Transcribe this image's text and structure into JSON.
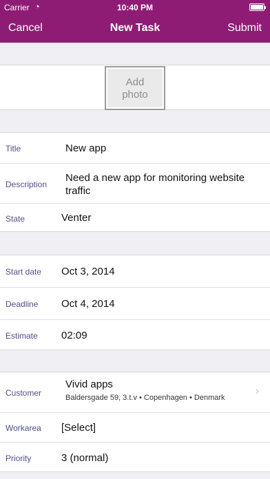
{
  "status": {
    "carrier": "Carrier",
    "time": "10:40 PM"
  },
  "nav": {
    "cancel": "Cancel",
    "title": "New Task",
    "submit": "Submit"
  },
  "photo": {
    "line1": "Add",
    "line2": "photo"
  },
  "task": {
    "title_label": "Title",
    "title_value": "New app",
    "description_label": "Description",
    "description_line1": "Need a new app for monitoring website",
    "description_line2": "traffic",
    "state_label": "State",
    "state_value": "Venter"
  },
  "schedule": {
    "start_label": "Start date",
    "start_value": "Oct 3, 2014",
    "deadline_label": "Deadline",
    "deadline_value": "Oct 4, 2014",
    "estimate_label": "Estimate",
    "estimate_value": "02:09"
  },
  "details": {
    "customer_label": "Customer",
    "customer_name": "Vivid apps",
    "customer_address": "Baldersgade 59, 3.t.v • Copenhagen • Denmark",
    "workarea_label": "Workarea",
    "workarea_value": "[Select]",
    "priority_label": "Priority",
    "priority_value": "3 (normal)"
  },
  "icons": {
    "wifi": "wifi-icon",
    "battery": "battery-icon",
    "chevron": "chevron-right-icon"
  },
  "colors": {
    "brand": "#8e1c75",
    "label": "#4f4f88",
    "background": "#efeff4"
  }
}
